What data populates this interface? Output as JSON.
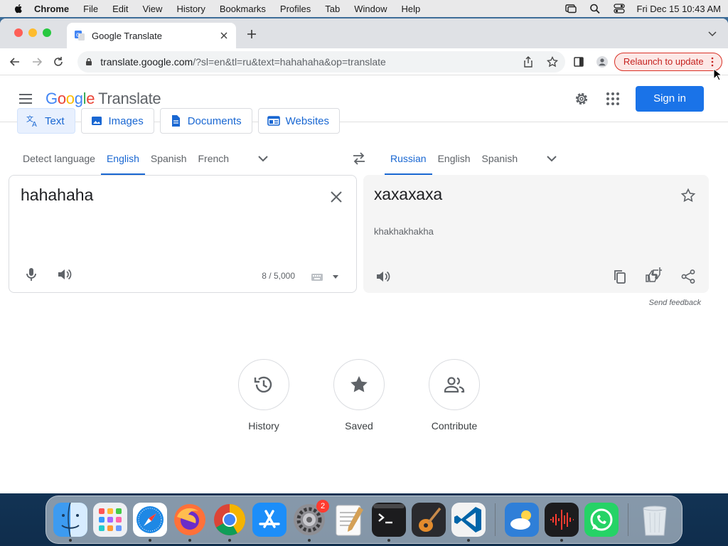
{
  "menubar": {
    "app": "Chrome",
    "items": [
      "File",
      "Edit",
      "View",
      "History",
      "Bookmarks",
      "Profiles",
      "Tab",
      "Window",
      "Help"
    ],
    "clock": "Fri Dec 15  10:43 AM"
  },
  "browser": {
    "tab_title": "Google Translate",
    "url_host": "translate.google.com",
    "url_rest": "/?sl=en&tl=ru&text=hahahaha&op=translate",
    "relaunch_label": "Relaunch to update"
  },
  "header": {
    "logo_letters": [
      "G",
      "o",
      "o",
      "g",
      "l",
      "e"
    ],
    "product": "Translate",
    "sign_in": "Sign in"
  },
  "modes": [
    {
      "label": "Text",
      "icon": "translate-icon",
      "active": true
    },
    {
      "label": "Images",
      "icon": "image-icon",
      "active": false
    },
    {
      "label": "Documents",
      "icon": "document-icon",
      "active": false
    },
    {
      "label": "Websites",
      "icon": "web-icon",
      "active": false
    }
  ],
  "source_langs": [
    "Detect language",
    "English",
    "Spanish",
    "French"
  ],
  "source_active": "English",
  "target_langs": [
    "Russian",
    "English",
    "Spanish"
  ],
  "target_active": "Russian",
  "source": {
    "text": "hahahaha",
    "char_count": "8 / 5,000"
  },
  "target": {
    "text": "хахахаха",
    "transliteration": "khakhakhakha"
  },
  "feedback": "Send feedback",
  "features": [
    {
      "label": "History",
      "icon": "history-icon"
    },
    {
      "label": "Saved",
      "icon": "star-icon"
    },
    {
      "label": "Contribute",
      "icon": "people-icon"
    }
  ],
  "dock": {
    "settings_badge": "2",
    "apps": [
      "finder",
      "launchpad",
      "safari",
      "firefox",
      "chrome",
      "app-store",
      "system-preferences",
      "textedit",
      "terminal",
      "garageband",
      "vscode",
      "weather",
      "voice-memos",
      "whatsapp",
      "trash"
    ]
  },
  "colors": {
    "accent": "#1a73e8",
    "accent_text": "#1967d2",
    "relaunch_red": "#d93025"
  }
}
